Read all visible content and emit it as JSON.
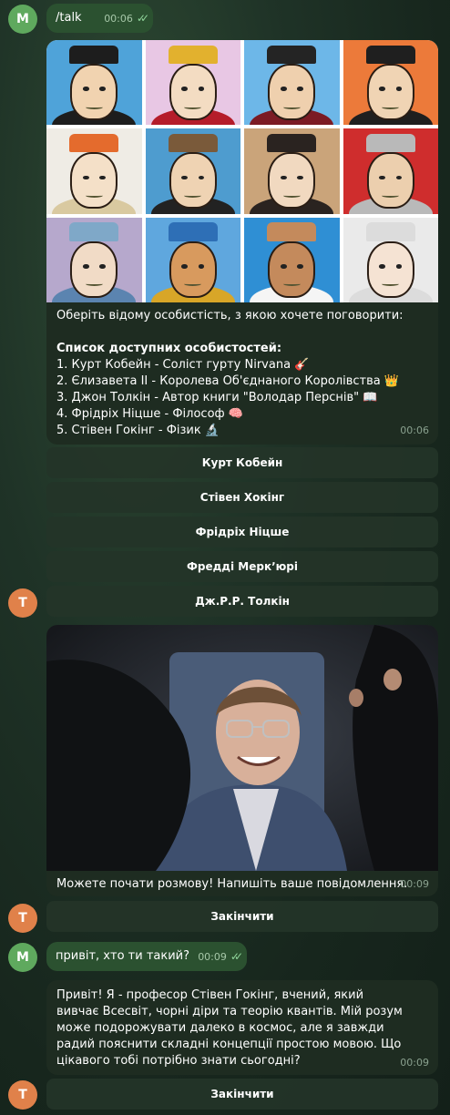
{
  "messages": {
    "m1": {
      "avatar": "M",
      "text": "/talk",
      "time": "00:06"
    },
    "m2": {
      "intro": "Оберіть відому особистість, з якою хочете поговорити:",
      "list_title": "Список доступних особистостей:",
      "items": [
        "1. Курт Кобейн - Соліст гурту Nirvana 🎸",
        "2. Єлизавета II - Королева Об'єднаного Королівства 👑",
        "3. Джон Толкін - Автор книги \"Володар Перснів\" 📖",
        "4. Фрідріх Ніцше - Філософ 🧠",
        "5. Стівен Гокінг - Фізик 🔬"
      ],
      "time": "00:06",
      "avatar": "T"
    },
    "choices": [
      "Курт Кобейн",
      "Стівен Хокінг",
      "Фрідріх Ніцше",
      "Фредді Меркʼюрі",
      "Дж.Р.Р. Толкін"
    ],
    "m3": {
      "text": "Можете почати розмову! Напишіть ваше повідомлення.",
      "time": "00:09",
      "avatar": "T",
      "button": "Закінчити"
    },
    "m4": {
      "avatar": "M",
      "text": "привіт, хто ти такий?",
      "time": "00:09"
    },
    "m5": {
      "text": "Привіт! Я - професор Стівен Гокінг, вчений, який вивчає Всесвіт, чорні діри та теорію квантів. Мій розум може подорожувати далеко в космос, але я завжди радий пояснити складні концепції простою мовою. Що цікавого тобі потрібно знати сьогодні?",
      "time": "00:09",
      "avatar": "T",
      "button": "Закінчити"
    }
  },
  "portraits": [
    {
      "name": "churchill-portrait",
      "bg": "#4fa3d9",
      "skin": "#f1d3b0",
      "hat": "#1d1d1d",
      "body": "#1d1d1d"
    },
    {
      "name": "queen-portrait",
      "bg": "#e8c7e4",
      "skin": "#f3dcc2",
      "hat": "#e2b12e",
      "body": "#b51c2a"
    },
    {
      "name": "tudor-king-portrait",
      "bg": "#6db7e8",
      "skin": "#efd0ae",
      "hat": "#242424",
      "body": "#7b1b24"
    },
    {
      "name": "king-portrait",
      "bg": "#ec7a3a",
      "skin": "#f0d4b4",
      "hat": "#1f1f1f",
      "body": "#1f1f1f"
    },
    {
      "name": "elizabeth-portrait",
      "bg": "#efece5",
      "skin": "#f4e0c8",
      "hat": "#e46b2d",
      "body": "#d9c9a0"
    },
    {
      "name": "shakespeare-portrait",
      "bg": "#4e9ccf",
      "skin": "#efd3b3",
      "hat": "#7a5a3a",
      "body": "#222222"
    },
    {
      "name": "anne-boleyn-portrait",
      "bg": "#caa47a",
      "skin": "#f1d9c0",
      "hat": "#2a2320",
      "body": "#2a2320"
    },
    {
      "name": "knight-portrait",
      "bg": "#cf2d2d",
      "skin": "#eccfae",
      "hat": "#b9b9b9",
      "body": "#b9b9b9"
    },
    {
      "name": "victorian-woman-portrait",
      "bg": "#b6a8cc",
      "skin": "#f1dbc6",
      "hat": "#7fa8c8",
      "body": "#5b84b0"
    },
    {
      "name": "pharaoh-portrait",
      "bg": "#5fa7de",
      "skin": "#d89a5e",
      "hat": "#2e6fb6",
      "body": "#d8a628"
    },
    {
      "name": "gandhi-portrait",
      "bg": "#2f8fd4",
      "skin": "#c48a5c",
      "hat": "#c48a5c",
      "body": "#f5f5f5"
    },
    {
      "name": "marie-antoinette-portrait",
      "bg": "#eaeaea",
      "skin": "#f5e3d3",
      "hat": "#dcdcdc",
      "body": "#dcdcdc"
    }
  ]
}
